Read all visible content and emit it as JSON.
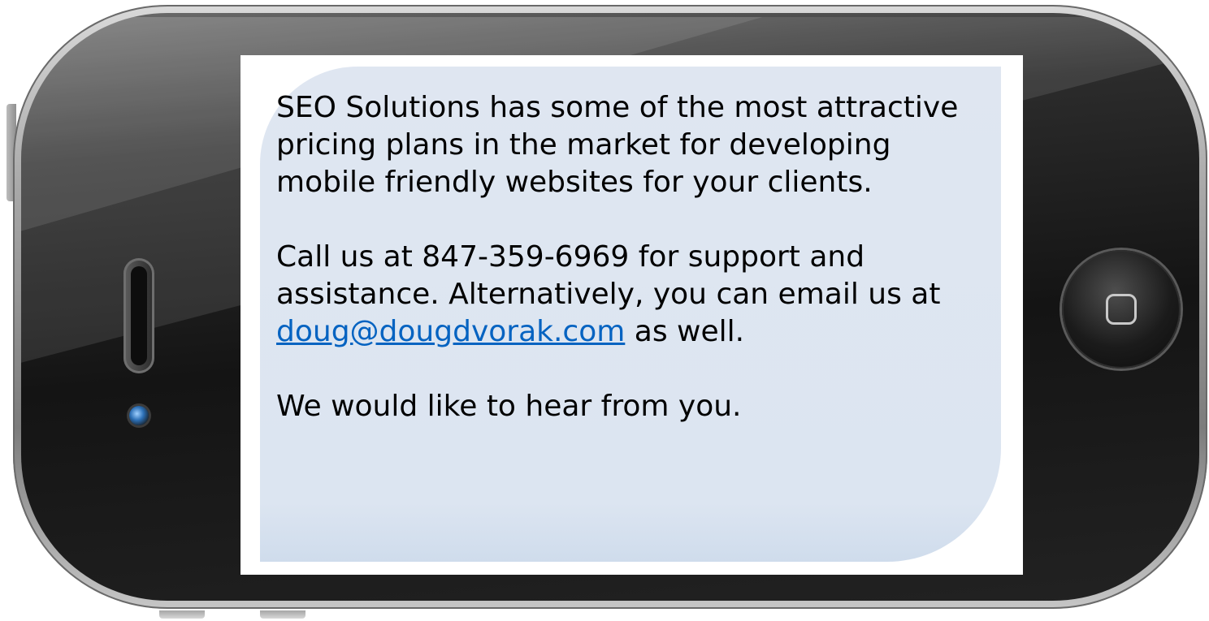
{
  "message": {
    "paragraph1": "SEO Solutions has some of the most attractive pricing plans in the market for developing mobile friendly websites for your clients.",
    "paragraph2_before": "Call us at 847-359-6969 for support and assistance. Alternatively, you can email us at ",
    "email": "doug@dougdvorak.com",
    "paragraph2_after": " as well.",
    "paragraph3": "We would like to hear from you."
  },
  "colors": {
    "link": "#0563c1",
    "bubble": "#dce5f1",
    "phone_body": "#141414"
  },
  "icons": {
    "home": "home-button-icon",
    "camera": "camera-icon",
    "speaker": "speaker-icon"
  }
}
